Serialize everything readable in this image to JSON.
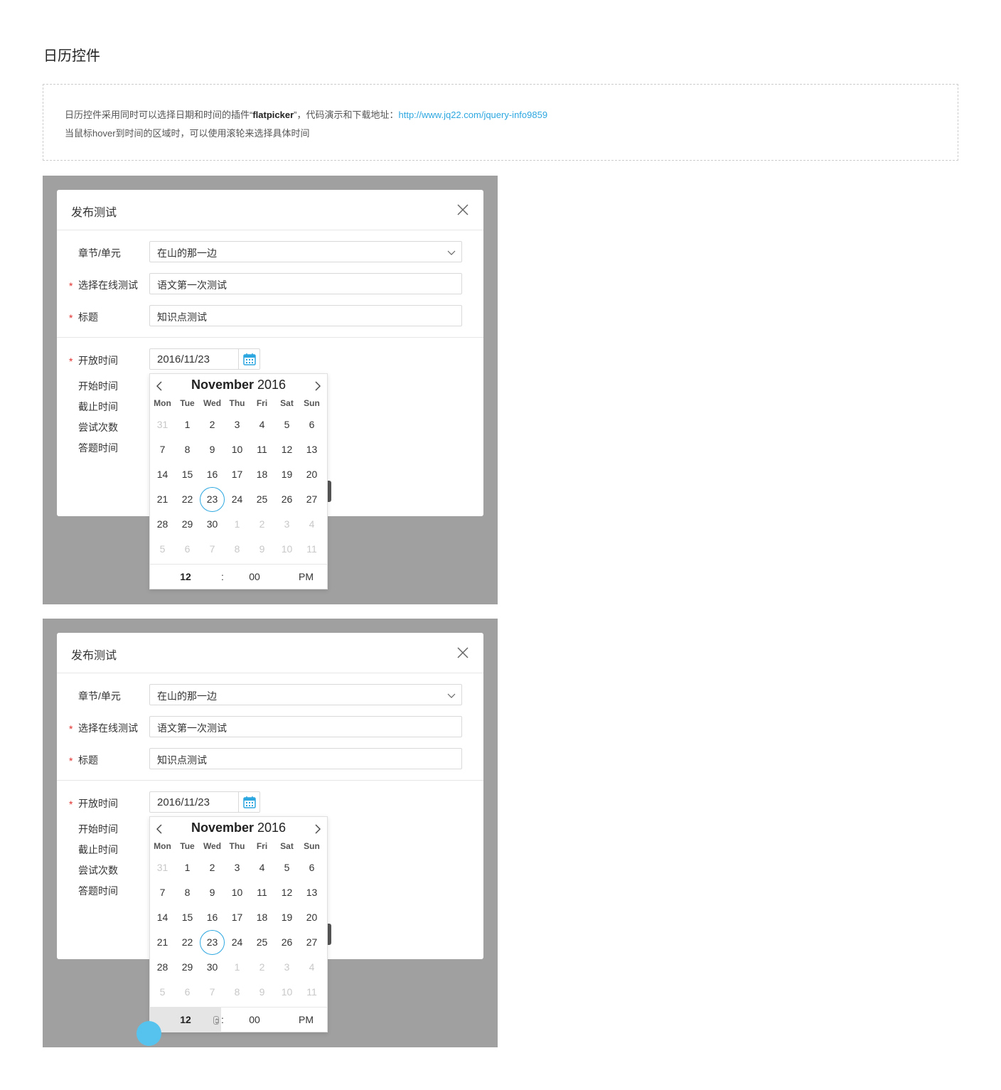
{
  "page": {
    "title": "日历控件",
    "note_line1_a": "日历控件采用同时可以选择日期和时间的插件“",
    "note_line1_b": "flatpicker",
    "note_line1_c": "”，代码演示和下载地址：",
    "note_link": "http://www.jq22.com/jquery-info9859",
    "note_line2": "当鼠标hover到时间的区域时，可以使用滚轮来选择具体时间"
  },
  "dialog": {
    "title": "发布测试",
    "close_icon": "close-icon",
    "chapter_label": "章节/单元",
    "chapter_value": "在山的那一边",
    "test_label": "选择在线测试",
    "test_value": "语文第一次测试",
    "title_label": "标题",
    "title_value": "知识点测试",
    "required_mark": "*",
    "open_time_label": "开放时间",
    "open_time_value": "2016/11/23",
    "start_time_label": "开始时间",
    "end_time_label": "截止时间",
    "attempts_label": "尝试次数",
    "answer_time_label": "答题时间"
  },
  "calendar": {
    "month": "November",
    "year": "2016",
    "weekdays": [
      "Mon",
      "Tue",
      "Wed",
      "Thu",
      "Fri",
      "Sat",
      "Sun"
    ],
    "days": [
      [
        "31",
        "1",
        "2",
        "3",
        "4",
        "5",
        "6"
      ],
      [
        "7",
        "8",
        "9",
        "10",
        "11",
        "12",
        "13"
      ],
      [
        "14",
        "15",
        "16",
        "17",
        "18",
        "19",
        "20"
      ],
      [
        "21",
        "22",
        "23",
        "24",
        "25",
        "26",
        "27"
      ],
      [
        "28",
        "29",
        "30",
        "1",
        "2",
        "3",
        "4"
      ],
      [
        "5",
        "6",
        "7",
        "8",
        "9",
        "10",
        "11"
      ]
    ],
    "selected_day": "23",
    "hour": "12",
    "separator": ":",
    "minute": "00",
    "ampm": "PM",
    "accent_color": "#2da7e0"
  }
}
